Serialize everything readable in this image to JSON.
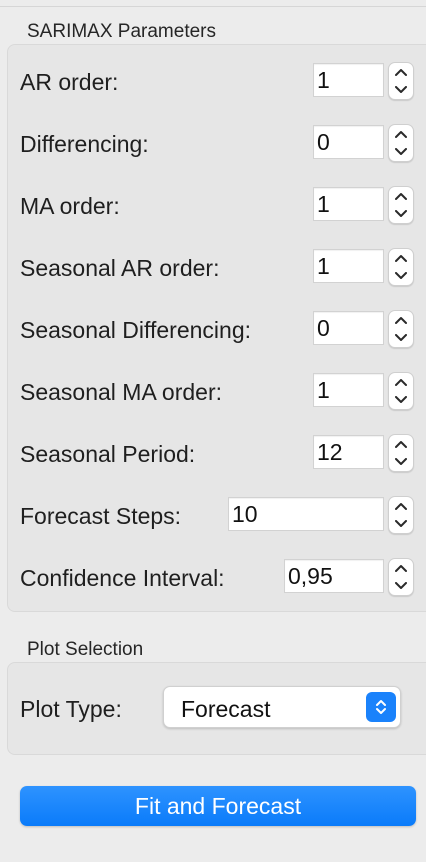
{
  "sarimax": {
    "title": "SARIMAX Parameters",
    "fields": [
      {
        "label": "AR order:",
        "value": "1"
      },
      {
        "label": "Differencing:",
        "value": "0"
      },
      {
        "label": "MA order:",
        "value": "1"
      },
      {
        "label": "Seasonal AR order:",
        "value": "1"
      },
      {
        "label": "Seasonal Differencing:",
        "value": "0"
      },
      {
        "label": "Seasonal MA order:",
        "value": "1"
      },
      {
        "label": "Seasonal Period:",
        "value": "12"
      },
      {
        "label": "Forecast Steps:",
        "value": "10"
      },
      {
        "label": "Confidence Interval:",
        "value": "0,95"
      }
    ]
  },
  "plot": {
    "title": "Plot Selection",
    "type_label": "Plot Type:",
    "type_value": "Forecast"
  },
  "actions": {
    "fit_label": "Fit and Forecast"
  },
  "colors": {
    "accent": "#0a7bfa",
    "background": "#ececec",
    "group_box": "#e6e6e6"
  },
  "icons": {
    "spinner_up": "chevron-up-icon",
    "spinner_down": "chevron-down-icon",
    "select_arrows": "up-down-chevron-icon"
  }
}
